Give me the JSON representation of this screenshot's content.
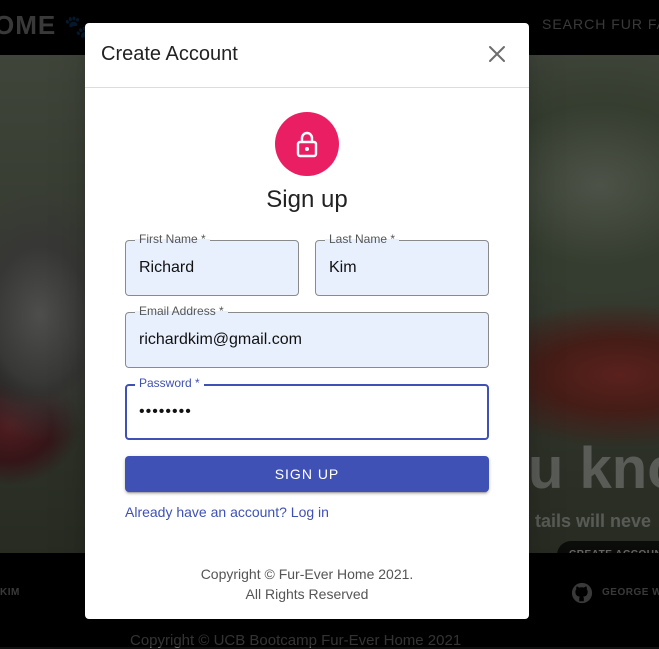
{
  "background": {
    "brand": "OME",
    "nav_search": "SEARCH FUR FA",
    "hero_headline": "u kno",
    "hero_subtitle": "tails will neve",
    "hero_cta": "CREATE ACCOUNT",
    "footer_left": "KIM",
    "footer_right": "GEORGE W",
    "footer_copyright": "Copyright © UCB Bootcamp Fur-Ever Home 2021"
  },
  "dialog": {
    "title": "Create Account",
    "heading": "Sign up",
    "fields": {
      "first_name": {
        "label": "First Name *",
        "value": "Richard"
      },
      "last_name": {
        "label": "Last Name *",
        "value": "Kim"
      },
      "email": {
        "label": "Email Address *",
        "value": "richardkim@gmail.com"
      },
      "password": {
        "label": "Password *",
        "value": "••••••••"
      }
    },
    "signup_button": "SIGN UP",
    "login_link": "Already have an account? Log in",
    "copyright_line1": "Copyright © Fur-Ever Home 2021.",
    "copyright_line2": "All Rights Reserved"
  },
  "colors": {
    "primary": "#3f51b5",
    "avatar": "#e91e63",
    "autofill": "#e8f0fe"
  },
  "icons": {
    "close": "close-icon",
    "lock": "lock-icon",
    "paw": "paw-icon",
    "github": "github-icon"
  }
}
